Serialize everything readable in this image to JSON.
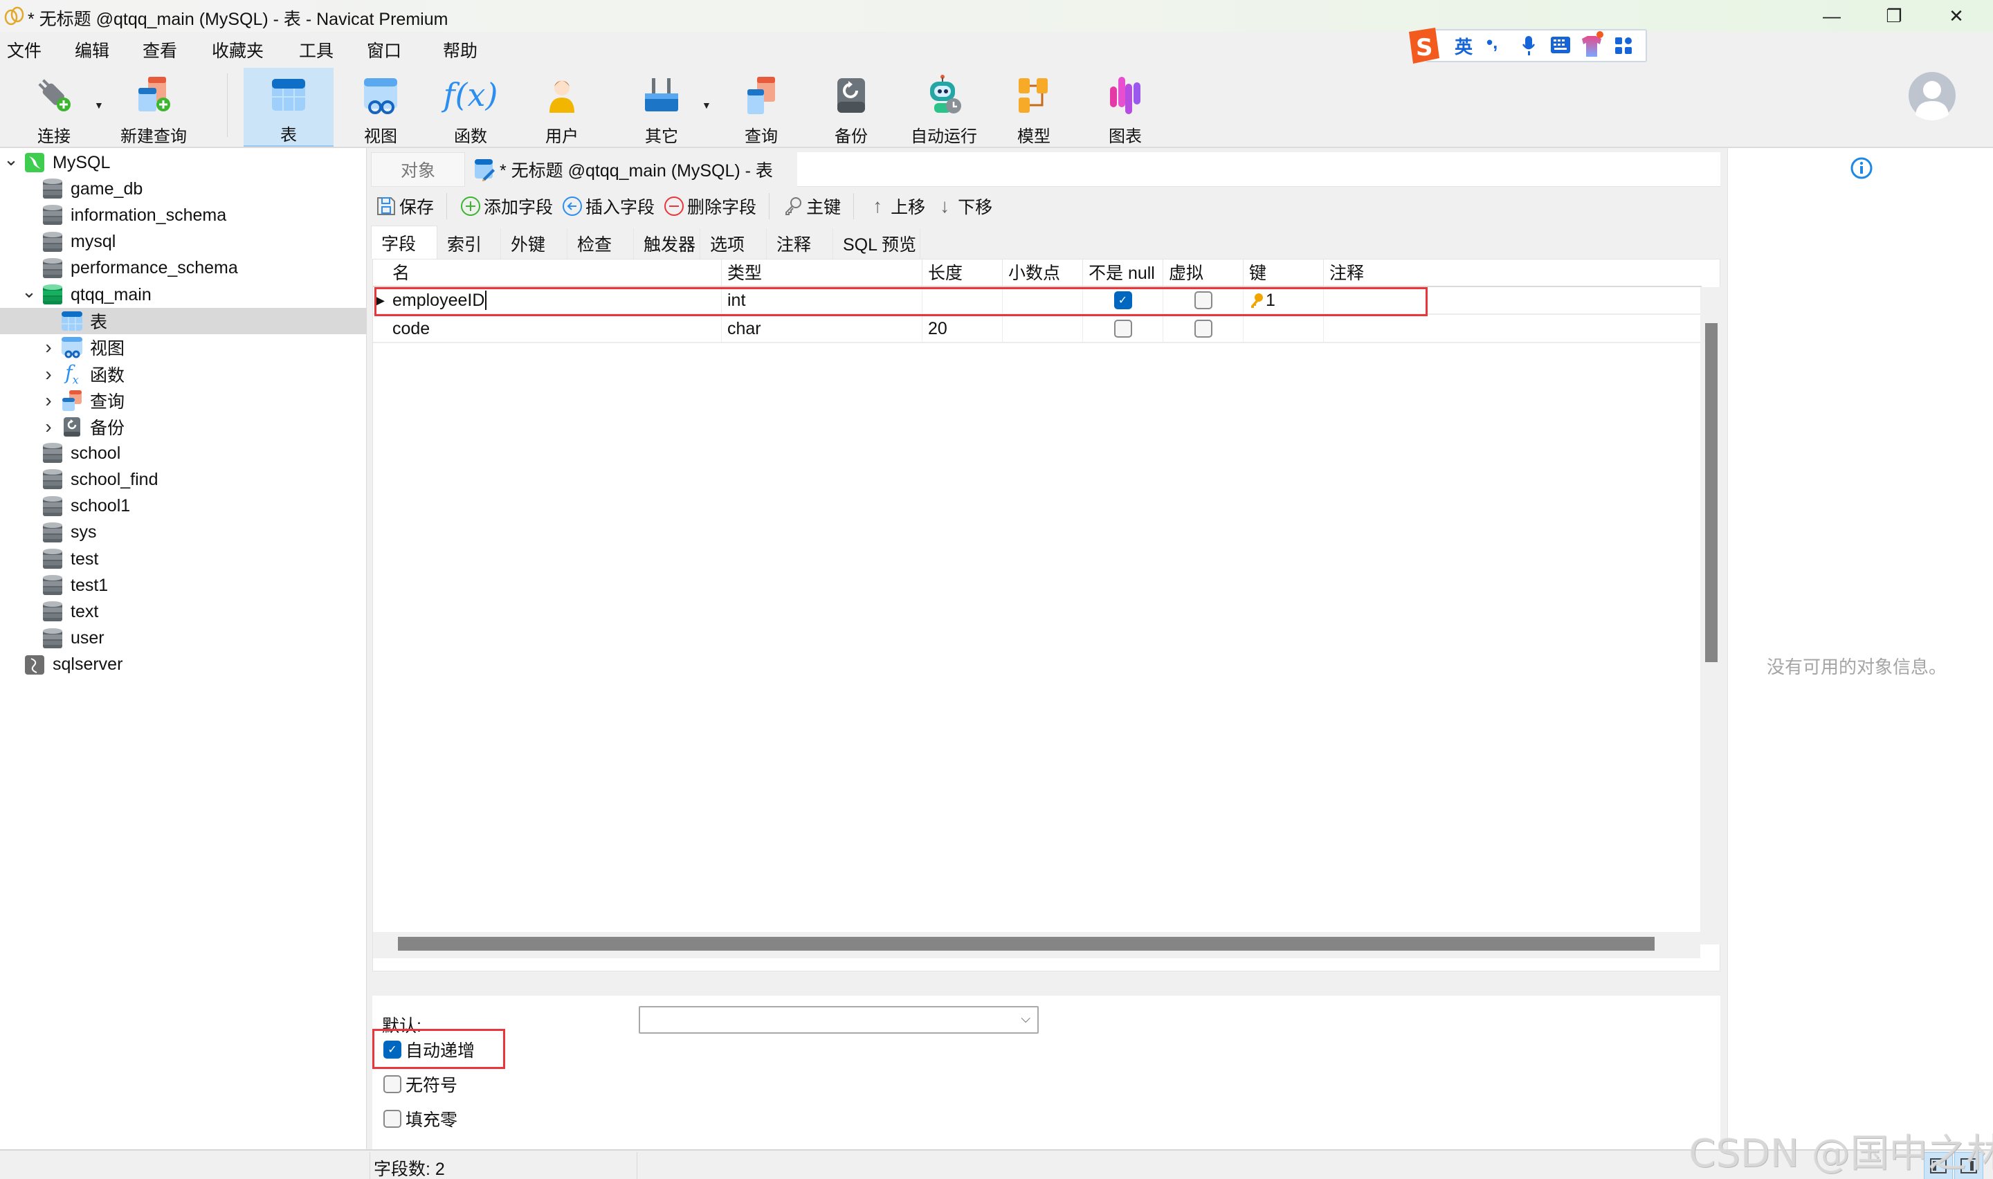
{
  "window": {
    "title": "* 无标题 @qtqq_main (MySQL) - 表 - Navicat Premium",
    "controls": {
      "minimize": "—",
      "restore": "❐",
      "close": "✕"
    }
  },
  "menu": [
    "文件",
    "编辑",
    "查看",
    "收藏夹",
    "工具",
    "窗口",
    "帮助"
  ],
  "ime": {
    "lang": "英",
    "punct": "•,"
  },
  "toolbar": {
    "items": [
      {
        "label": "连接",
        "icon": "plug-add-icon"
      },
      {
        "label": "新建查询",
        "icon": "new-query-icon"
      },
      {
        "label": "表",
        "icon": "table-icon",
        "active": true
      },
      {
        "label": "视图",
        "icon": "view-icon"
      },
      {
        "label": "函数",
        "icon": "function-icon",
        "glyph": "f(x)"
      },
      {
        "label": "用户",
        "icon": "user-icon"
      },
      {
        "label": "其它",
        "icon": "tools-icon"
      },
      {
        "label": "查询",
        "icon": "query-icon"
      },
      {
        "label": "备份",
        "icon": "backup-icon"
      },
      {
        "label": "自动运行",
        "icon": "robot-icon"
      },
      {
        "label": "模型",
        "icon": "model-icon"
      },
      {
        "label": "图表",
        "icon": "chart-icon"
      }
    ]
  },
  "sidebar": {
    "tree": [
      {
        "label": "MySQL",
        "level": 0,
        "type": "connection-mysql",
        "expanded": true
      },
      {
        "label": "game_db",
        "level": 1,
        "type": "database"
      },
      {
        "label": "information_schema",
        "level": 1,
        "type": "database"
      },
      {
        "label": "mysql",
        "level": 1,
        "type": "database"
      },
      {
        "label": "performance_schema",
        "level": 1,
        "type": "database"
      },
      {
        "label": "qtqq_main",
        "level": 1,
        "type": "database-open",
        "expanded": true
      },
      {
        "label": "表",
        "level": 2,
        "type": "tables",
        "selected": true
      },
      {
        "label": "视图",
        "level": 2,
        "type": "views",
        "collapsed": true
      },
      {
        "label": "函数",
        "level": 2,
        "type": "functions",
        "collapsed": true
      },
      {
        "label": "查询",
        "level": 2,
        "type": "queries",
        "collapsed": true
      },
      {
        "label": "备份",
        "level": 2,
        "type": "backups",
        "collapsed": true
      },
      {
        "label": "school",
        "level": 1,
        "type": "database"
      },
      {
        "label": "school_find",
        "level": 1,
        "type": "database"
      },
      {
        "label": "school1",
        "level": 1,
        "type": "database"
      },
      {
        "label": "sys",
        "level": 1,
        "type": "database"
      },
      {
        "label": "test",
        "level": 1,
        "type": "database"
      },
      {
        "label": "test1",
        "level": 1,
        "type": "database"
      },
      {
        "label": "text",
        "level": 1,
        "type": "database"
      },
      {
        "label": "user",
        "level": 1,
        "type": "database"
      },
      {
        "label": "sqlserver",
        "level": 0,
        "type": "connection-sqlserver"
      }
    ]
  },
  "tabs": {
    "objects": "对象",
    "active_doc": "* 无标题 @qtqq_main (MySQL) - 表"
  },
  "edit_toolbar": {
    "save": "保存",
    "add_field": "添加字段",
    "insert_field": "插入字段",
    "delete_field": "删除字段",
    "primary_key": "主键",
    "move_up": "上移",
    "move_down": "下移"
  },
  "subtabs": [
    "字段",
    "索引",
    "外键",
    "检查",
    "触发器",
    "选项",
    "注释",
    "SQL 预览"
  ],
  "grid": {
    "columns": [
      "名",
      "类型",
      "长度",
      "小数点",
      "不是 null",
      "虚拟",
      "键",
      "注释"
    ],
    "rows": [
      {
        "name": "employeeID",
        "type": "int",
        "length": "",
        "decimals": "",
        "not_null": true,
        "virtual": false,
        "key": "1",
        "comment": "",
        "current": true
      },
      {
        "name": "code",
        "type": "char",
        "length": "20",
        "decimals": "",
        "not_null": false,
        "virtual": false,
        "key": "",
        "comment": "",
        "current": false
      }
    ]
  },
  "props": {
    "default_label": "默认:",
    "default_value": "",
    "auto_increment": {
      "label": "自动递增",
      "checked": true
    },
    "unsigned": {
      "label": "无符号",
      "checked": false
    },
    "zerofill": {
      "label": "填充零",
      "checked": false
    }
  },
  "info_panel": {
    "message": "没有可用的对象信息。"
  },
  "status": {
    "field_count": "字段数: 2"
  },
  "watermark": "CSDN @国中之林",
  "colors": {
    "accent": "#0067c0",
    "highlight": "#e8363b",
    "selected_tool": "#cce4f7"
  }
}
